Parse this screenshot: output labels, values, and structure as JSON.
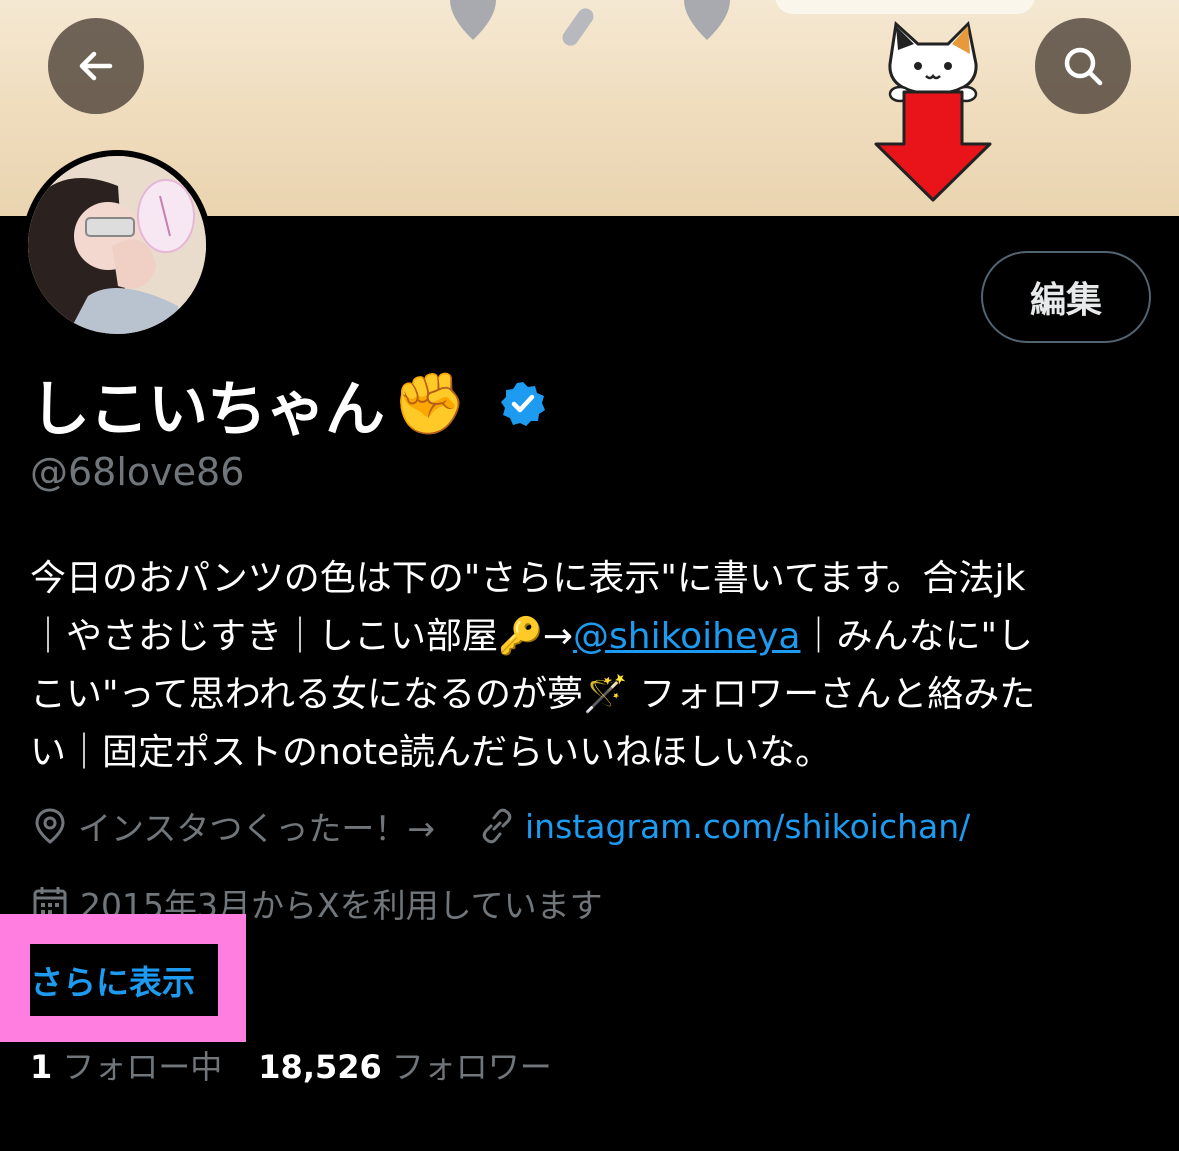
{
  "header": {
    "back_icon": "arrow-left-icon",
    "search_icon": "search-icon"
  },
  "profile": {
    "display_name": "しこいちゃん",
    "name_emoji": "✊",
    "verified": true,
    "handle": "@68love86",
    "edit_label": "編集",
    "bio_lines": [
      "今日のおパンツの色は下の\"さらに表示\"に書いてます。合法jk",
      "｜やさおじすき｜しこい部屋🔑→",
      "@shikoiheya",
      "｜みんなに\"し",
      "こい\"って思われる女になるのが夢🪄 フォロワーさんと絡みた",
      "い｜固定ポストのnote読んだらいいねほしいな。"
    ],
    "location": "インスタつくったー！→",
    "website": "instagram.com/shikoichan/",
    "joined": "2015年3月からXを利用しています",
    "show_more": "さらに表示",
    "following_count": "1",
    "following_label": "フォロー中",
    "followers_count": "18,526",
    "followers_label": "フォロワー"
  },
  "colors": {
    "background": "#000000",
    "text_primary": "#e7e9ea",
    "text_secondary": "#71767b",
    "link": "#1d9bf0",
    "highlight": "#ff7ee0",
    "banner": "#efdcbc"
  }
}
